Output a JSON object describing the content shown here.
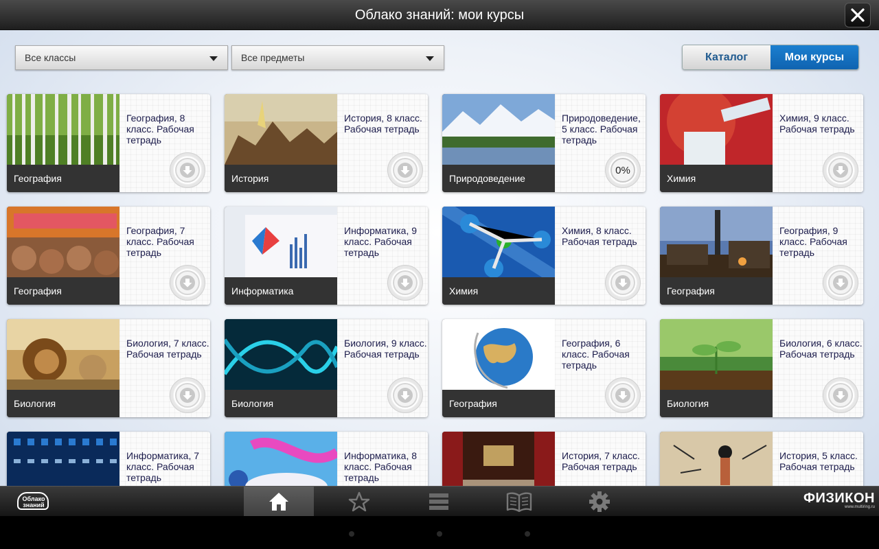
{
  "header": {
    "title": "Облако знаний: мои курсы"
  },
  "filters": {
    "grade": "Все классы",
    "subject": "Все предметы"
  },
  "tabs": {
    "catalog": "Каталог",
    "mine": "Мои курсы"
  },
  "courses": [
    {
      "subject": "География",
      "title": "География, 8 класс. Рабочая тетрадь",
      "status": "download"
    },
    {
      "subject": "История",
      "title": "История, 8 класс. Рабочая тетрадь",
      "status": "download"
    },
    {
      "subject": "Природоведение",
      "title": "Природоведение, 5 класс. Рабочая тетрадь",
      "status": "progress",
      "progress_label": "0%"
    },
    {
      "subject": "Химия",
      "title": "Химия, 9 класс. Рабочая тетрадь",
      "status": "download"
    },
    {
      "subject": "География",
      "title": "География, 7 класс. Рабочая тетрадь",
      "status": "download"
    },
    {
      "subject": "Информатика",
      "title": "Информатика, 9 класс. Рабочая тетрадь",
      "status": "download"
    },
    {
      "subject": "Химия",
      "title": "Химия, 8 класс. Рабочая тетрадь",
      "status": "download"
    },
    {
      "subject": "География",
      "title": "География, 9 класс. Рабочая тетрадь",
      "status": "download"
    },
    {
      "subject": "Биология",
      "title": "Биология, 7 класс. Рабочая тетрадь",
      "status": "download"
    },
    {
      "subject": "Биология",
      "title": "Биология, 9 класс. Рабочая тетрадь",
      "status": "download"
    },
    {
      "subject": "География",
      "title": "География, 6 класс. Рабочая тетрадь",
      "status": "download"
    },
    {
      "subject": "Биология",
      "title": "Биология, 6 класс. Рабочая тетрадь",
      "status": "download"
    },
    {
      "subject": "",
      "title": "Информатика, 7 класс. Рабочая тетрадь",
      "status": "download"
    },
    {
      "subject": "",
      "title": "Информатика, 8 класс. Рабочая тетрадь",
      "status": "download"
    },
    {
      "subject": "",
      "title": "История, 7 класс. Рабочая тетрадь",
      "status": "download"
    },
    {
      "subject": "",
      "title": "История, 5 класс. Рабочая тетрадь",
      "status": "download"
    }
  ],
  "bottom_nav": {
    "logo_left_line1": "Облако",
    "logo_left_line2": "знаний",
    "logo_right": "ФИЗИКОН",
    "logo_right_site": "www.multiring.ru",
    "items": [
      "home-icon",
      "star-icon",
      "list-icon",
      "book-icon",
      "gear-icon"
    ],
    "active": "home-icon"
  },
  "colors": {
    "accent": "#1172c4",
    "catalog_text": "#1f5a8f",
    "subject_bar": "#333333"
  }
}
